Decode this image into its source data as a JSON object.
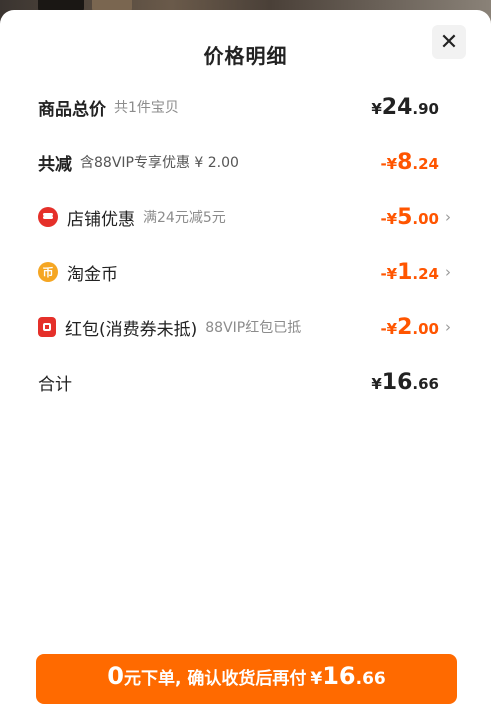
{
  "title": "价格明细",
  "close_glyph": "✕",
  "rows": {
    "total": {
      "label": "商品总价",
      "sub": "共1件宝贝",
      "yen": "¥",
      "int": "24",
      "dec": ".90"
    },
    "discount": {
      "label": "共减",
      "sub": "含88VIP专享优惠 ¥ 2.00",
      "yen": "-¥",
      "int": "8",
      "dec": ".24"
    },
    "store": {
      "label": "店铺优惠",
      "sub": "满24元减5元",
      "yen": "-¥",
      "int": "5",
      "dec": ".00",
      "icon": "store-icon"
    },
    "coin": {
      "label": "淘金币",
      "yen": "-¥",
      "int": "1",
      "dec": ".24",
      "icon": "coin-icon",
      "icon_glyph": "币"
    },
    "redpacket": {
      "label": "红包(消费券未抵)",
      "sub": "88VIP红包已抵",
      "yen": "-¥",
      "int": "2",
      "dec": ".00",
      "icon": "red-packet-icon"
    },
    "sum": {
      "label": "合计",
      "yen": "¥",
      "int": "16",
      "dec": ".66"
    }
  },
  "cta": {
    "zero": "0",
    "text": "元下单, 确认收货后再付",
    "yen": "¥",
    "int": "16",
    "dec": ".66"
  },
  "colors": {
    "accent": "#ff5500",
    "button": "#ff6a00",
    "icon_red": "#e5302a",
    "icon_gold": "#f5a623"
  }
}
